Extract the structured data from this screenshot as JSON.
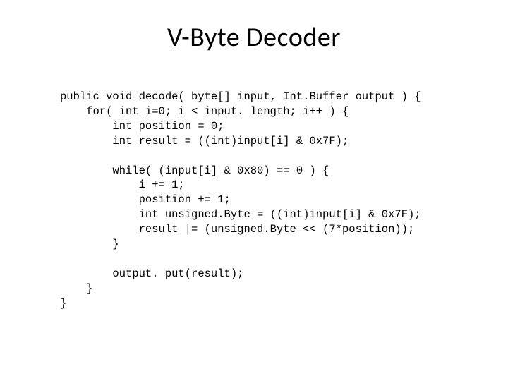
{
  "title": "V-Byte Decoder",
  "code": {
    "l01": "public void decode( byte[] input, Int.Buffer output ) {",
    "l02": "    for( int i=0; i < input. length; i++ ) {",
    "l03": "        int position = 0;",
    "l04": "        int result = ((int)input[i] & 0x7F);",
    "l05": "",
    "l06": "        while( (input[i] & 0x80) == 0 ) {",
    "l07": "            i += 1;",
    "l08": "            position += 1;",
    "l09": "            int unsigned.Byte = ((int)input[i] & 0x7F);",
    "l10": "            result |= (unsigned.Byte << (7*position));",
    "l11": "        }",
    "l12": "",
    "l13": "        output. put(result);",
    "l14": "    }",
    "l15": "}"
  }
}
